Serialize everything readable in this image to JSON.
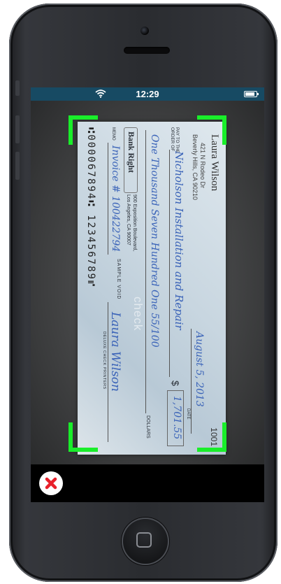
{
  "status_bar": {
    "time": "12:29"
  },
  "check": {
    "account_holder": "Laura Wilson",
    "address_line1": "421 N Rodeo Dr",
    "address_line2": "Beverly Hills, CA 90210",
    "check_number": "1001",
    "date_label": "DATE",
    "date": "August 5, 2013",
    "pay_to_label_line1": "PAY TO THE",
    "pay_to_label_line2": "ORDER OF",
    "payee": "Nicholson Installation and Repair",
    "currency_symbol": "$",
    "amount": "1,701.55",
    "amount_words": "One Thousand Seven Hundred One 55/100",
    "dollars_label": "DOLLARS",
    "bank_name": "Bank Right",
    "bank_address_line1": "900 Exposition Boulevard,",
    "bank_address_line2": "Los Angeles, CA 90007",
    "memo_label": "MEMO",
    "memo": "Invoice # 100422794",
    "sample_text": "SAMPLE VOID",
    "signature": "Laura Wilson",
    "printer_text": "DELUXE CHECK PRINTERS",
    "overlay_text": "check",
    "micr_line": "⑆000067894⑆ 123456789⑈"
  },
  "colors": {
    "guide_corners": "#19ee2a",
    "status_bar": "#174a63",
    "cancel_icon": "#e8202a"
  },
  "icons": {
    "wifi": "wifi-icon",
    "battery": "battery-icon",
    "cancel": "close-icon"
  }
}
